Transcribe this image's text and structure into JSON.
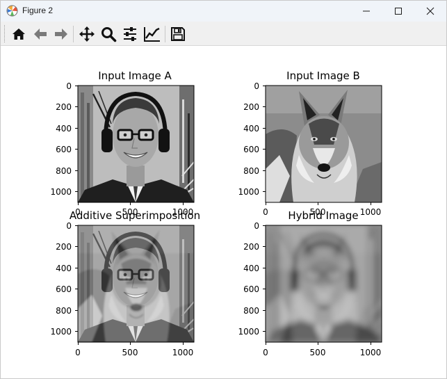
{
  "window": {
    "title": "Figure 2",
    "controls": [
      "minimize",
      "maximize",
      "close"
    ]
  },
  "toolbar": {
    "buttons": [
      {
        "icon": "home-icon",
        "label": "Home"
      },
      {
        "icon": "back-arrow-icon",
        "label": "Back"
      },
      {
        "icon": "forward-arrow-icon",
        "label": "Forward"
      },
      {
        "icon": "pan-icon",
        "label": "Pan"
      },
      {
        "icon": "zoom-icon",
        "label": "Zoom"
      },
      {
        "icon": "subplots-icon",
        "label": "Configure subplots"
      },
      {
        "icon": "edit-axis-icon",
        "label": "Edit axis"
      },
      {
        "icon": "save-icon",
        "label": "Save"
      }
    ]
  },
  "figure": {
    "panels": [
      {
        "title": "Input Image A",
        "content": "grayscale photo of smiling man with glasses and headphones",
        "x_ticks": [
          "0",
          "500",
          "1000"
        ],
        "y_ticks": [
          "0",
          "200",
          "400",
          "600",
          "800",
          "1000"
        ]
      },
      {
        "title": "Input Image B",
        "content": "grayscale photo of a wolf",
        "x_ticks": [
          "0",
          "500",
          "1000"
        ],
        "y_ticks": [
          "0",
          "200",
          "400",
          "600",
          "800",
          "1000"
        ]
      },
      {
        "title": "Additive Superimposition",
        "content": "man and wolf images overlaid",
        "x_ticks": [
          "0",
          "500",
          "1000"
        ],
        "y_ticks": [
          "0",
          "200",
          "400",
          "600",
          "800",
          "1000"
        ]
      },
      {
        "title": "Hybrid Image",
        "content": "blurred hybrid of man and wolf",
        "x_ticks": [
          "0",
          "500",
          "1000"
        ],
        "y_ticks": [
          "0",
          "200",
          "400",
          "600",
          "800",
          "1000"
        ]
      }
    ]
  }
}
